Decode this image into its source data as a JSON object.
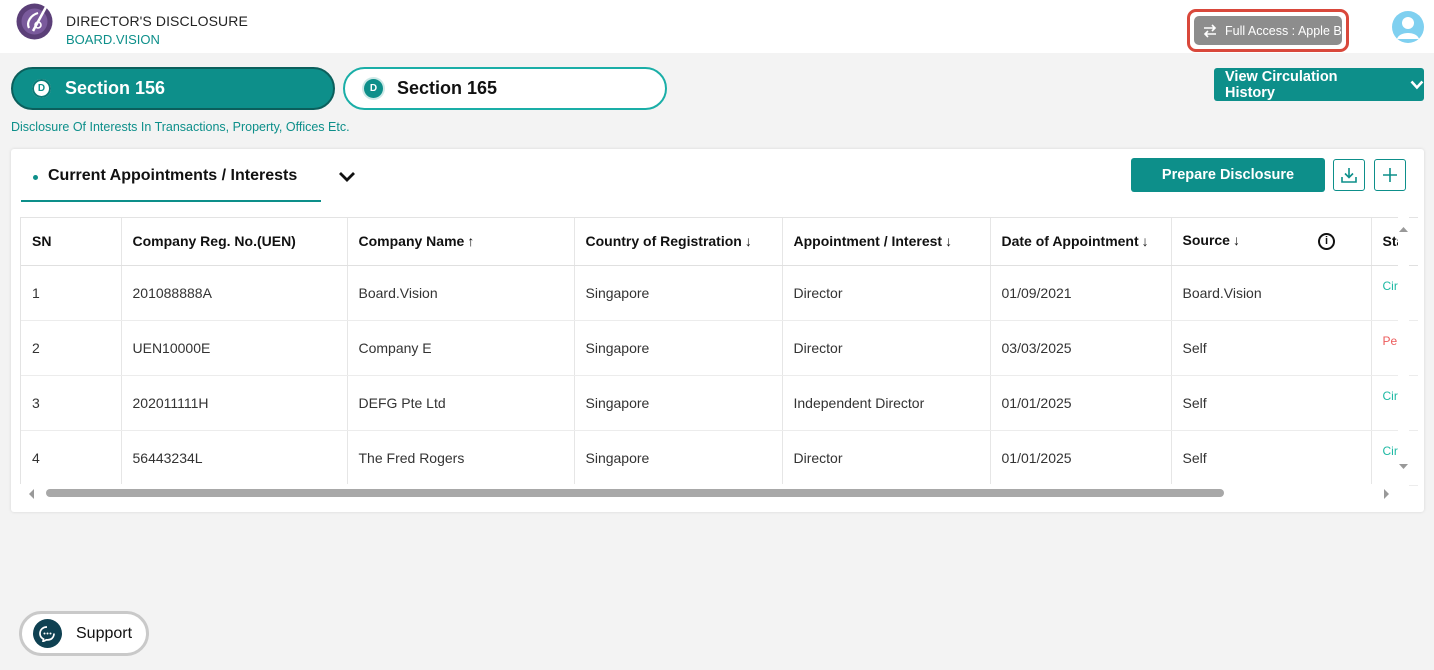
{
  "header": {
    "brand_title": "DIRECTOR'S DISCLOSURE",
    "brand_subtitle": "BOARD.VISION",
    "access_label": "Full Access : Apple B"
  },
  "sections": {
    "tab1": {
      "badge": "D",
      "label": "Section 156"
    },
    "tab2": {
      "badge": "D",
      "label": "Section 165"
    },
    "subtitle": "Disclosure Of Interests In Transactions, Property, Offices Etc."
  },
  "view_history_label": "View Circulation History",
  "card": {
    "tab_label": "Current Appointments / Interests",
    "prepare_label": "Prepare Disclosure"
  },
  "table": {
    "columns": [
      {
        "label": "SN",
        "arrow": ""
      },
      {
        "label": "Company Reg. No.(UEN)",
        "arrow": ""
      },
      {
        "label": "Company Name",
        "arrow": "↑"
      },
      {
        "label": "Country of Registration",
        "arrow": "↓"
      },
      {
        "label": "Appointment / Interest",
        "arrow": "↓"
      },
      {
        "label": "Date of Appointment",
        "arrow": "↓"
      },
      {
        "label": "Source",
        "arrow": "↓"
      },
      {
        "label": "Sta",
        "arrow": ""
      }
    ],
    "rows": [
      [
        "1",
        "201088888A",
        "Board.Vision",
        "Singapore",
        "Director",
        "01/09/2021",
        "Board.Vision",
        "Cir"
      ],
      [
        "2",
        "UEN10000E",
        "Company E",
        "Singapore",
        "Director",
        "03/03/2025",
        "Self",
        "Pe"
      ],
      [
        "3",
        "202011111H",
        "DEFG Pte Ltd",
        "Singapore",
        "Independent Director",
        "01/01/2025",
        "Self",
        "Cir"
      ],
      [
        "4",
        "56443234L",
        "The Fred Rogers",
        "Singapore",
        "Director",
        "01/01/2025",
        "Self",
        "Cir"
      ]
    ],
    "status_colors": [
      "#1fb9a4",
      "#ec5a5a",
      "#1fb9a4",
      "#1fb9a4"
    ]
  },
  "support_label": "Support",
  "colors": {
    "accent": "#0d8f8a",
    "highlight": "#d9483b"
  }
}
